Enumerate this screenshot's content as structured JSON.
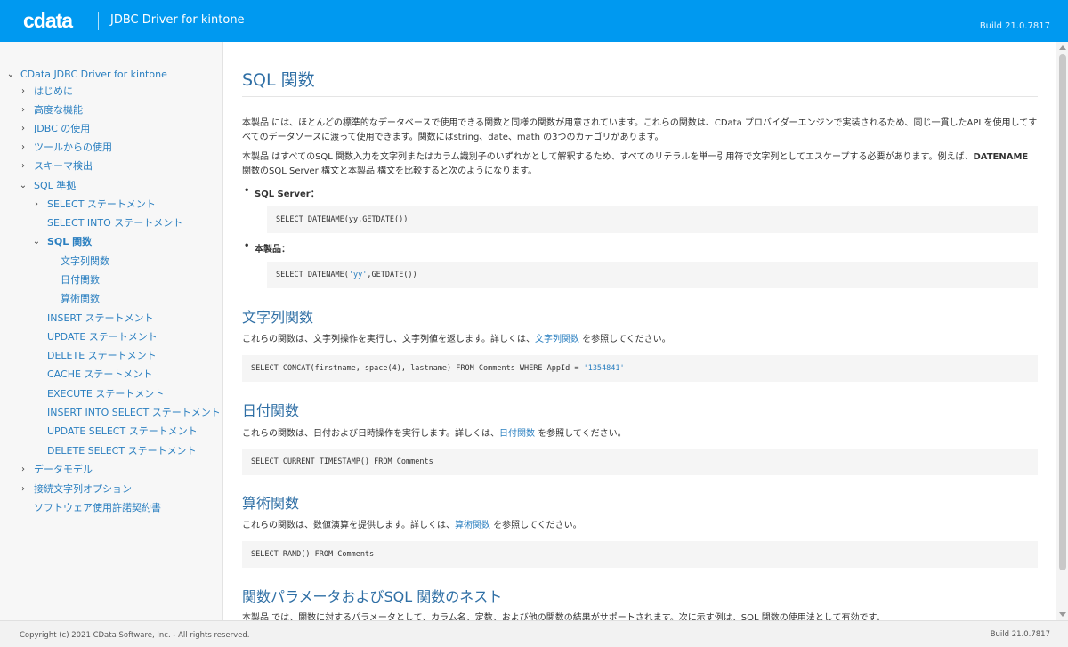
{
  "header": {
    "logo_text": "cdata",
    "product_title": "JDBC Driver for kintone",
    "build": "Build 21.0.7817"
  },
  "sidebar": {
    "root": "CData JDBC Driver for kintone",
    "items": [
      {
        "label": "はじめに"
      },
      {
        "label": "高度な機能"
      },
      {
        "label": "JDBC の使用"
      },
      {
        "label": "ツールからの使用"
      },
      {
        "label": "スキーマ検出"
      },
      {
        "label": "SQL 準拠"
      },
      {
        "label": "SELECT ステートメント"
      },
      {
        "label": "SELECT INTO ステートメント"
      },
      {
        "label": "SQL 関数"
      },
      {
        "label": "文字列関数"
      },
      {
        "label": "日付関数"
      },
      {
        "label": "算術関数"
      },
      {
        "label": "INSERT ステートメント"
      },
      {
        "label": "UPDATE ステートメント"
      },
      {
        "label": "DELETE ステートメント"
      },
      {
        "label": "CACHE ステートメント"
      },
      {
        "label": "EXECUTE ステートメント"
      },
      {
        "label": "INSERT INTO SELECT ステートメント"
      },
      {
        "label": "UPDATE SELECT ステートメント"
      },
      {
        "label": "DELETE SELECT ステートメント"
      },
      {
        "label": "データモデル"
      },
      {
        "label": "接続文字列オプション"
      },
      {
        "label": "ソフトウェア使用許諾契約書"
      }
    ]
  },
  "content": {
    "title": "SQL 関数",
    "intro": "本製品 には、ほとんどの標準的なデータベースで使用できる関数と同様の関数が用意されています。これらの関数は、CData プロバイダーエンジンで実装されるため、同じ一貫したAPI を使用してすべてのデータソースに渡って使用できます。関数にはstring、date、math の3つのカテゴリがあります。",
    "para2_a": "本製品 はすべてのSQL 関数入力を文字列またはカラム識別子のいずれかとして解釈するため、すべてのリテラルを単一引用符で文字列としてエスケープする必要があります。例えば、",
    "para2_bold": "DATENAME",
    "para2_b": " 関数のSQL Server 構文と本製品 構文を比較すると次のようになります。",
    "bullet_sqlserver": "SQL Server：",
    "code_sqlserver": "SELECT DATENAME(yy,GETDATE())",
    "bullet_product": "本製品：",
    "code_product_a": "SELECT DATENAME(",
    "code_product_str": "'yy'",
    "code_product_b": ",GETDATE())",
    "h_string": "文字列関数",
    "string_text_a": "これらの関数は、文字列操作を実行し、文字列値を返します。詳しくは、",
    "string_link": "文字列関数",
    "string_text_b": " を参照してください。",
    "code_string_a": "SELECT CONCAT(firstname, space(4), lastname) FROM Comments WHERE AppId = ",
    "code_string_str": "'1354841'",
    "h_date": "日付関数",
    "date_text_a": "これらの関数は、日付および日時操作を実行します。詳しくは、",
    "date_link": "日付関数",
    "date_text_b": " を参照してください。",
    "code_date": "SELECT CURRENT_TIMESTAMP() FROM Comments",
    "h_math": "算術関数",
    "math_text_a": "これらの関数は、数値演算を提供します。詳しくは、",
    "math_link": "算術関数",
    "math_text_b": " を参照してください。",
    "code_math": "SELECT RAND() FROM Comments",
    "h_nest": "関数パラメータおよびSQL 関数のネスト",
    "nest_text": "本製品 では、関数に対するパラメータとして、カラム名、定数、および他の関数の結果がサポートされます。次に示す例は、SQL 関数の使用法として有効です。"
  },
  "footer": {
    "copyright": "Copyright (c) 2021 CData Software, Inc. - All rights reserved.",
    "build": "Build 21.0.7817"
  }
}
